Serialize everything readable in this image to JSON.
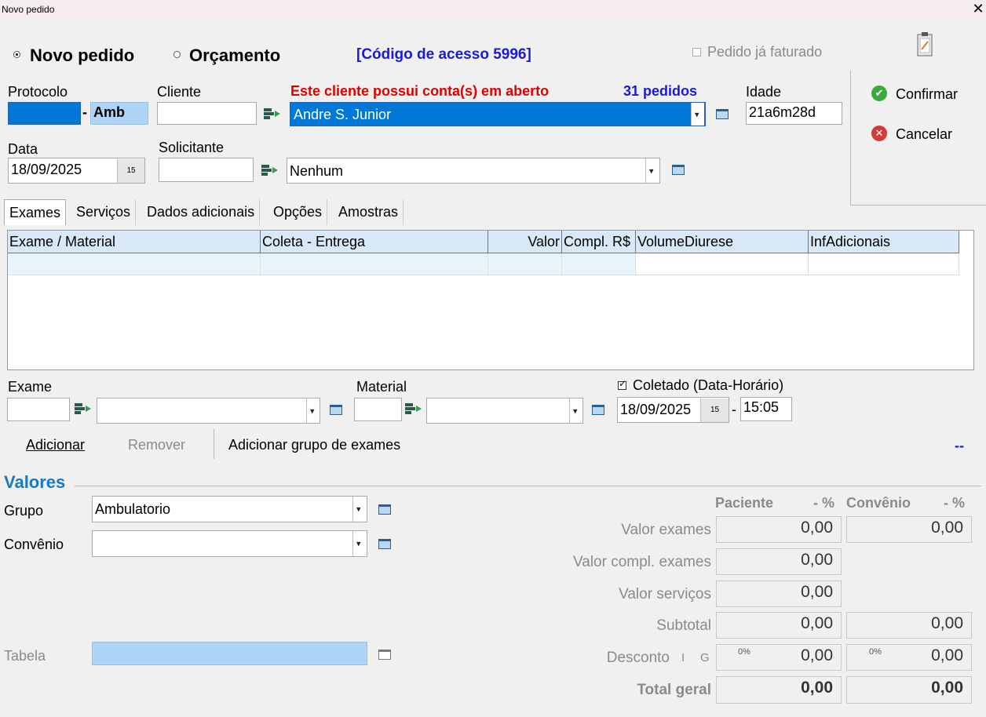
{
  "window": {
    "title": "Novo pedido"
  },
  "mode": {
    "novo_pedido_label": "Novo pedido",
    "orcamento_label": "Orçamento",
    "selected": "novo_pedido"
  },
  "access_code": "[Código de acesso 5996]",
  "pedido_faturado_label": "Pedido já faturado",
  "fields": {
    "protocolo_label": "Protocolo",
    "protocolo_value": "",
    "protocolo_suffix": "Amb",
    "cliente_label": "Cliente",
    "cliente_code": "",
    "cliente_warning": "Este cliente possui conta(s) em aberto",
    "cliente_pedidos": "31 pedidos",
    "cliente_name": "Andre S. Junior",
    "idade_label": "Idade",
    "idade_value": "21a6m28d",
    "data_label": "Data",
    "data_value": "18/09/2025",
    "solicitante_label": "Solicitante",
    "solicitante_code": "",
    "solicitante_name": "Nenhum"
  },
  "actions": {
    "confirmar": "Confirmar",
    "cancelar": "Cancelar"
  },
  "tabs": [
    "Exames",
    "Serviços",
    "Dados adicionais",
    "Opções",
    "Amostras"
  ],
  "grid": {
    "columns": [
      "Exame / Material",
      "Coleta - Entrega",
      "Valor",
      "Compl. R$",
      "VolumeDiurese",
      "InfAdicionais"
    ]
  },
  "exam_entry": {
    "exame_label": "Exame",
    "material_label": "Material",
    "coletado_label": "Coletado (Data-Horário)",
    "coletado_checked": true,
    "coleta_date": "18/09/2025",
    "coleta_time": "15:05"
  },
  "exam_actions": {
    "adicionar": "Adicionar",
    "remover": "Remover",
    "adicionar_grupo": "Adicionar grupo de exames",
    "status": "--"
  },
  "valores": {
    "section_title": "Valores",
    "grupo_label": "Grupo",
    "grupo_value": "Ambulatorio",
    "convenio_label": "Convênio",
    "convenio_value": "",
    "tabela_label": "Tabela",
    "col_paciente": "Paciente",
    "col_pct1": "- %",
    "col_convenio": "Convênio",
    "col_pct2": "- %",
    "rows": {
      "valor_exames_label": "Valor exames",
      "valor_exames_paciente": "0,00",
      "valor_exames_convenio": "0,00",
      "valor_compl_label": "Valor compl. exames",
      "valor_compl_paciente": "0,00",
      "valor_servicos_label": "Valor serviços",
      "valor_servicos_paciente": "0,00",
      "subtotal_label": "Subtotal",
      "subtotal_paciente": "0,00",
      "subtotal_convenio": "0,00",
      "desconto_label": "Desconto",
      "desconto_i": "I",
      "desconto_g": "G",
      "desconto_paciente_pct": "0%",
      "desconto_paciente": "0,00",
      "desconto_convenio_pct": "0%",
      "desconto_convenio": "0,00",
      "total_label": "Total geral",
      "total_paciente": "0,00",
      "total_convenio": "0,00"
    }
  }
}
